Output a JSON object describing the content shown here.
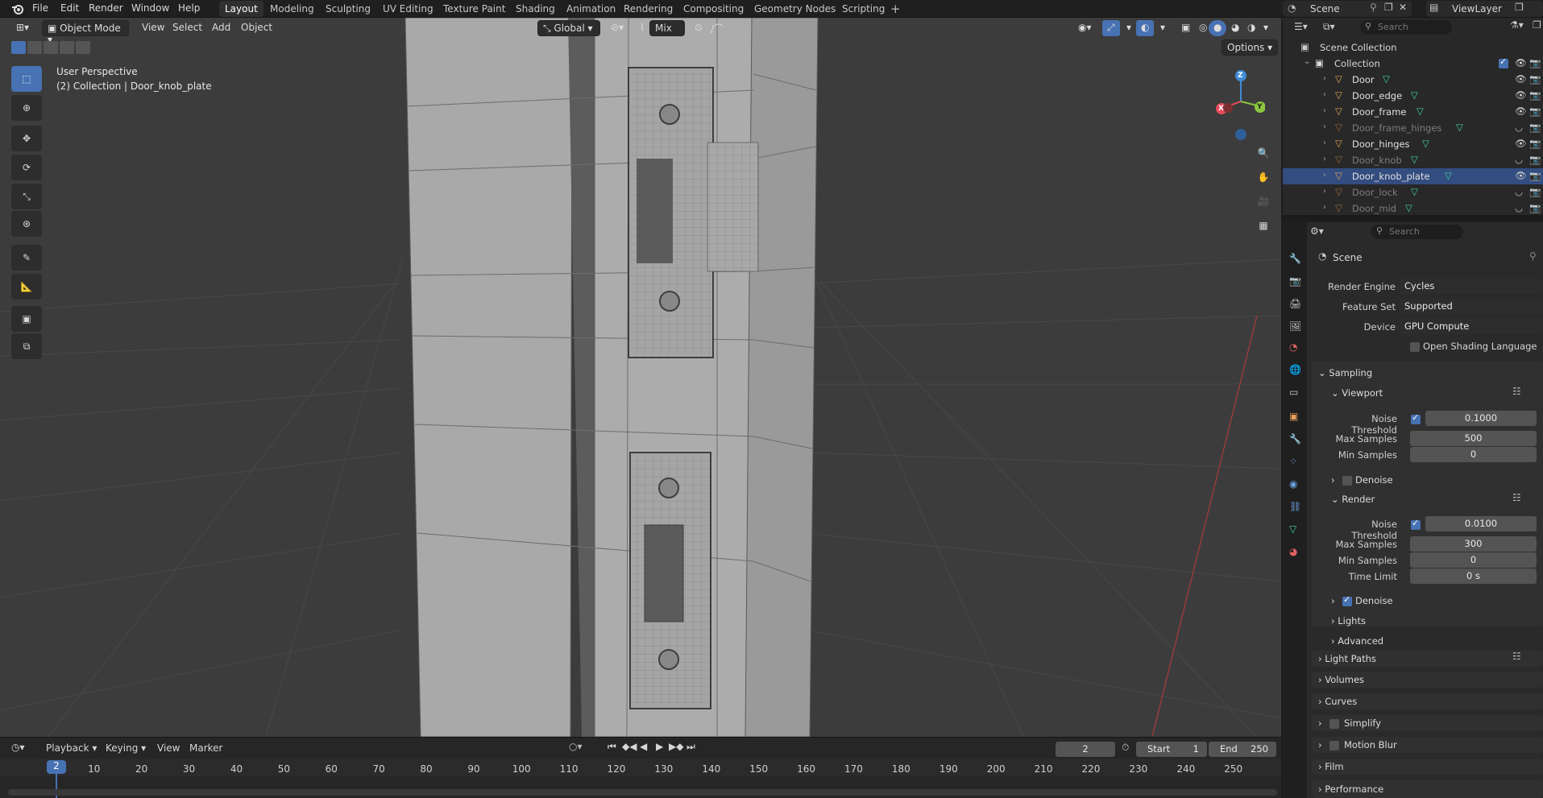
{
  "topbar": {
    "menus": [
      "File",
      "Edit",
      "Render",
      "Window",
      "Help"
    ],
    "workspaces": [
      "Layout",
      "Modeling",
      "Sculpting",
      "UV Editing",
      "Texture Paint",
      "Shading",
      "Animation",
      "Rendering",
      "Compositing",
      "Geometry Nodes",
      "Scripting"
    ],
    "active_workspace": "Layout",
    "scene_label": "Scene",
    "view_layer_label": "ViewLayer"
  },
  "viewport": {
    "mode": "Object Mode",
    "menus": [
      "View",
      "Select",
      "Add",
      "Object"
    ],
    "orientation": "Global",
    "pivot_mix": "Mix",
    "options_label": "Options",
    "overlay_title": "User Perspective",
    "overlay_subtitle": "(2) Collection | Door_knob_plate",
    "axes": {
      "z": "Z",
      "x": "X",
      "y": "Y"
    }
  },
  "timeline": {
    "menus": [
      "Playback",
      "Keying",
      "View",
      "Marker"
    ],
    "current_frame": "2",
    "start_label": "Start",
    "start_value": "1",
    "end_label": "End",
    "end_value": "250",
    "ticks": [
      "10",
      "20",
      "30",
      "40",
      "50",
      "60",
      "70",
      "80",
      "90",
      "100",
      "110",
      "120",
      "130",
      "140",
      "150",
      "160",
      "170",
      "180",
      "190",
      "200",
      "210",
      "220",
      "230",
      "240",
      "250"
    ],
    "playhead_label": "2"
  },
  "outliner": {
    "search_placeholder": "Search",
    "scene_collection": "Scene Collection",
    "collection": "Collection",
    "items": [
      {
        "name": "Door",
        "dim": false,
        "visible": true
      },
      {
        "name": "Door_edge",
        "dim": false,
        "visible": true
      },
      {
        "name": "Door_frame",
        "dim": false,
        "visible": true
      },
      {
        "name": "Door_frame_hinges",
        "dim": true,
        "visible": false
      },
      {
        "name": "Door_hinges",
        "dim": false,
        "visible": true
      },
      {
        "name": "Door_knob",
        "dim": true,
        "visible": false
      },
      {
        "name": "Door_knob_plate",
        "dim": false,
        "visible": true
      },
      {
        "name": "Door_lock",
        "dim": true,
        "visible": false
      },
      {
        "name": "Door_mid",
        "dim": true,
        "visible": false
      }
    ]
  },
  "properties": {
    "search_placeholder": "Search",
    "scene": "Scene",
    "render_engine_label": "Render Engine",
    "render_engine": "Cycles",
    "feature_set_label": "Feature Set",
    "feature_set": "Supported",
    "device_label": "Device",
    "device": "GPU Compute",
    "osl_label": "Open Shading Language",
    "sampling": "Sampling",
    "viewport_panel": "Viewport",
    "noise_threshold_label": "Noise Threshold",
    "vp_noise_threshold": "0.1000",
    "max_samples_label": "Max Samples",
    "vp_max_samples": "500",
    "min_samples_label": "Min Samples",
    "vp_min_samples": "0",
    "denoise_label": "Denoise",
    "render_panel": "Render",
    "r_noise_threshold": "0.0100",
    "r_max_samples": "300",
    "r_min_samples": "0",
    "time_limit_label": "Time Limit",
    "r_time_limit": "0 s",
    "lights": "Lights",
    "advanced": "Advanced",
    "light_paths": "Light Paths",
    "volumes": "Volumes",
    "curves": "Curves",
    "simplify": "Simplify",
    "motion_blur": "Motion Blur",
    "film": "Film",
    "performance": "Performance"
  },
  "colors": {
    "accent": "#4772b3",
    "mesh_icon": "#3fd2a0",
    "object_icon": "#e8a25a",
    "axis_x": "#e84b5b",
    "axis_y": "#8cc63f",
    "axis_z": "#3f8bd8"
  }
}
